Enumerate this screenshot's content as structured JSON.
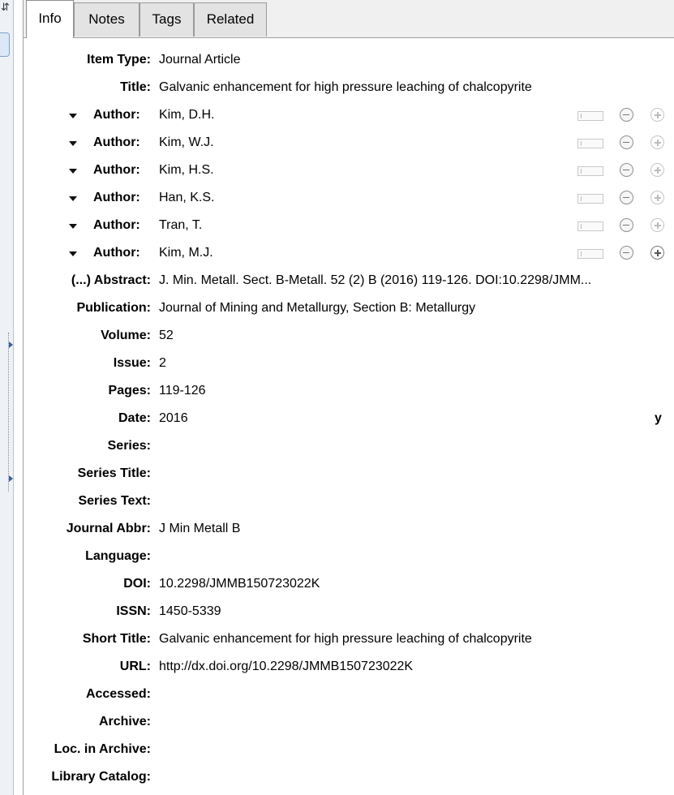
{
  "left_strip": {
    "top_glyph": "⇵"
  },
  "tabs": [
    "Info",
    "Notes",
    "Tags",
    "Related"
  ],
  "fields": {
    "item_type": {
      "label": "Item Type:",
      "value": "Journal Article"
    },
    "title": {
      "label": "Title:",
      "value": "Galvanic enhancement for high pressure leaching of chalcopyrite"
    },
    "abstract": {
      "label": "(...) Abstract:",
      "value": "J. Min. Metall. Sect. B-Metall. 52 (2) B (2016) 119-126. DOI:10.2298/JMM..."
    },
    "publication": {
      "label": "Publication:",
      "value": "Journal of Mining and Metallurgy, Section B: Metallurgy"
    },
    "volume": {
      "label": "Volume:",
      "value": "52"
    },
    "issue": {
      "label": "Issue:",
      "value": "2"
    },
    "pages": {
      "label": "Pages:",
      "value": "119-126"
    },
    "date": {
      "label": "Date:",
      "value": "2016",
      "flag": "y"
    },
    "series": {
      "label": "Series:",
      "value": ""
    },
    "series_title": {
      "label": "Series Title:",
      "value": ""
    },
    "series_text": {
      "label": "Series Text:",
      "value": ""
    },
    "journal_abbr": {
      "label": "Journal Abbr:",
      "value": "J Min Metall B"
    },
    "language": {
      "label": "Language:",
      "value": ""
    },
    "doi": {
      "label": "DOI:",
      "value": "10.2298/JMMB150723022K"
    },
    "issn": {
      "label": "ISSN:",
      "value": "1450-5339"
    },
    "short_title": {
      "label": "Short Title:",
      "value": "Galvanic enhancement for high pressure leaching of chalcopyrite"
    },
    "url": {
      "label": "URL:",
      "value": "http://dx.doi.org/10.2298/JMMB150723022K"
    },
    "accessed": {
      "label": "Accessed:",
      "value": ""
    },
    "archive": {
      "label": "Archive:",
      "value": ""
    },
    "loc_in_archive": {
      "label": "Loc. in Archive:",
      "value": ""
    },
    "library_catalog": {
      "label": "Library Catalog:",
      "value": ""
    }
  },
  "author_label": "Author:",
  "authors": [
    "Kim, D.H.",
    "Kim, W.J.",
    "Kim, H.S.",
    "Han, K.S.",
    "Tran, T.",
    "Kim, M.J."
  ],
  "icons": {
    "creator_menu": "triangle-down-icon",
    "swap_names": "name-mode-toggle-icon",
    "remove": "minus-circle-icon",
    "add": "plus-circle-icon"
  },
  "colors": {
    "tab_bar": "#f0f0f0",
    "left_strip": "#eef1f6",
    "border": "#a0a0a0"
  }
}
